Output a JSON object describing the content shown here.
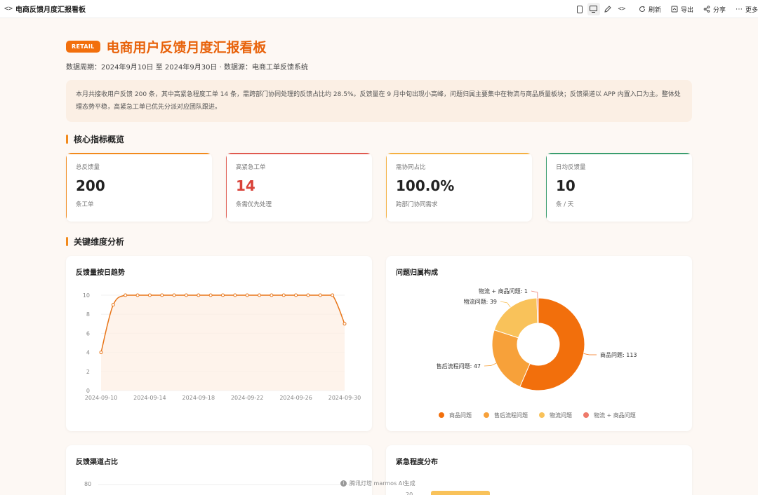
{
  "topbar": {
    "title": "电商反馈月度汇报看板",
    "refresh": "刷新",
    "export": "导出",
    "share": "分享",
    "more": "更多"
  },
  "header": {
    "badge": "RETAIL",
    "title": "电商用户反馈月度汇报看板",
    "subtitle": "数据周期：2024年9月10日 至 2024年9月30日 · 数据源：电商工单反馈系统"
  },
  "summary": "本月共接收用户反馈 200 条，其中高紧急程度工单 14 条，需跨部门协同处理的反馈占比约 28.5%。反馈量在 9 月中旬出现小高峰，问题归属主要集中在物流与商品质量板块；反馈渠道以 APP 内置入口为主。整体处理态势平稳，高紧急工单已优先分派对应团队跟进。",
  "sections": {
    "kpi": "核心指标概览",
    "analysis": "关键维度分析"
  },
  "kpis": [
    {
      "label": "总反馈量",
      "value": "200",
      "note": "条工单",
      "accent": "#f28a1c",
      "value_color": "#222222"
    },
    {
      "label": "高紧急工单",
      "value": "14",
      "note": "条需优先处理",
      "accent": "#e05a4f",
      "value_color": "#d9433a"
    },
    {
      "label": "需协同占比",
      "value": "100.0%",
      "note": "跨部门协同需求",
      "accent": "#f5b041",
      "value_color": "#222222"
    },
    {
      "label": "日均反馈量",
      "value": "10",
      "note": "条 / 天",
      "accent": "#3a9d6e",
      "value_color": "#222222"
    }
  ],
  "panels": {
    "trend": "反馈量按日趋势",
    "composition": "问题归属构成",
    "channel": "反馈渠道占比",
    "urgency": "紧急程度分布"
  },
  "chart_data": [
    {
      "type": "area",
      "title": "反馈量按日趋势",
      "x": [
        "2024-09-10",
        "2024-09-11",
        "2024-09-12",
        "2024-09-13",
        "2024-09-14",
        "2024-09-15",
        "2024-09-16",
        "2024-09-17",
        "2024-09-18",
        "2024-09-19",
        "2024-09-20",
        "2024-09-21",
        "2024-09-22",
        "2024-09-23",
        "2024-09-24",
        "2024-09-25",
        "2024-09-26",
        "2024-09-27",
        "2024-09-28",
        "2024-09-29",
        "2024-09-30"
      ],
      "values": [
        4,
        9,
        10,
        10,
        10,
        10,
        10,
        10,
        10,
        10,
        10,
        10,
        10,
        10,
        10,
        10,
        10,
        10,
        10,
        10,
        7
      ],
      "x_tick_labels": [
        "2024-09-10",
        "2024-09-14",
        "2024-09-18",
        "2024-09-22",
        "2024-09-26",
        "2024-09-30"
      ],
      "y_ticks": [
        0,
        2,
        4,
        6,
        8,
        10
      ],
      "ylim": [
        0,
        10
      ],
      "color": "#e8761a",
      "grid": true
    },
    {
      "type": "pie",
      "title": "问题归属构成",
      "labels": [
        "商品问题",
        "售后流程问题",
        "物流问题",
        "物流 + 商品问题"
      ],
      "values": [
        113,
        47,
        39,
        1
      ],
      "slice_labels": [
        "商品问题: 113",
        "售后流程问题: 47",
        "物流问题: 39",
        "物流 + 商品问题: 1"
      ],
      "colors": [
        "#f26f0c",
        "#f7a13a",
        "#f9c25a",
        "#ee7a6a"
      ],
      "donut": true,
      "legend": "bottom"
    },
    {
      "type": "bar",
      "title": "反馈渠道占比",
      "y_ticks": [
        80
      ],
      "note": "partially visible"
    },
    {
      "type": "bar",
      "title": "紧急程度分布",
      "y_ticks": [
        "20"
      ],
      "color": "#f9c25a",
      "note": "partially visible"
    }
  ],
  "watermark": "腾讯灯塔 marmos AI生成"
}
